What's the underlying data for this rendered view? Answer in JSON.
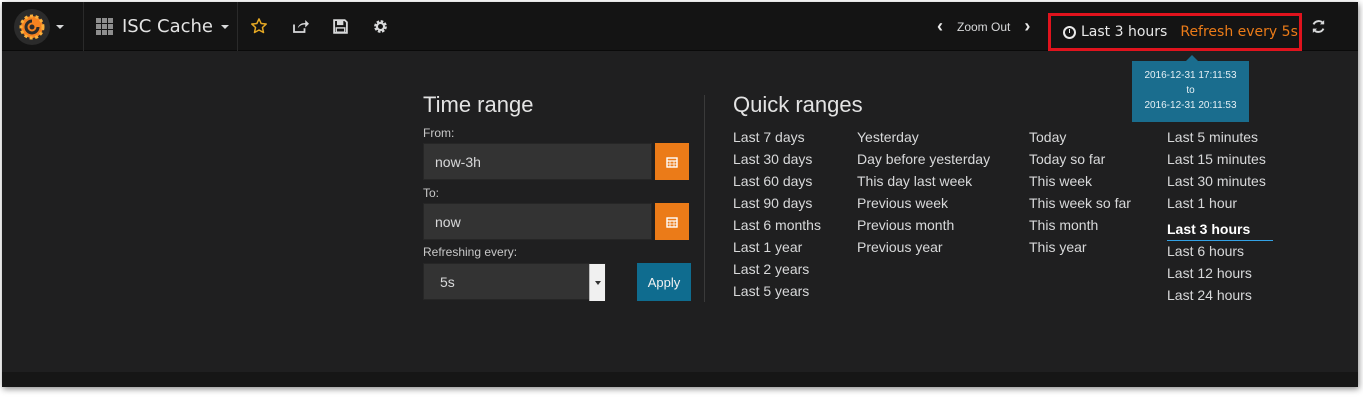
{
  "navbar": {
    "logo_icon": "grafana-logo-icon",
    "dashboard_title": "ISC Cache",
    "star_icon": "star-icon",
    "share_icon": "share-icon",
    "save_icon": "save-icon",
    "settings_icon": "gear-icon",
    "zoom_out_label": "Zoom Out",
    "time_range_label": "Last 3 hours",
    "refresh_label": "Refresh every 5s",
    "refresh_icon": "refresh-icon",
    "highlight_color": "#e0131d",
    "accent_color": "#eb7b18"
  },
  "tooltip": {
    "from": "2016-12-31 17:11:53",
    "to_word": "to",
    "to": "2016-12-31 20:11:53"
  },
  "time_range": {
    "heading": "Time range",
    "from_label": "From:",
    "from_value": "now-3h",
    "to_label": "To:",
    "to_value": "now",
    "refreshing_label": "Refreshing every:",
    "refresh_value": "5s",
    "apply_label": "Apply",
    "calendar_icon": "calendar-icon"
  },
  "quick_ranges": {
    "heading": "Quick ranges",
    "col1": [
      "Last 7 days",
      "Last 30 days",
      "Last 60 days",
      "Last 90 days",
      "Last 6 months",
      "Last 1 year",
      "Last 2 years",
      "Last 5 years"
    ],
    "col2": [
      "Yesterday",
      "Day before yesterday",
      "This day last week",
      "Previous week",
      "Previous month",
      "Previous year"
    ],
    "col3": [
      "Today",
      "Today so far",
      "This week",
      "This week so far",
      "This month",
      "This year"
    ],
    "col4": [
      "Last 5 minutes",
      "Last 15 minutes",
      "Last 30 minutes",
      "Last 1 hour",
      "Last 3 hours",
      "Last 6 hours",
      "Last 12 hours",
      "Last 24 hours"
    ],
    "active": "Last 3 hours"
  }
}
